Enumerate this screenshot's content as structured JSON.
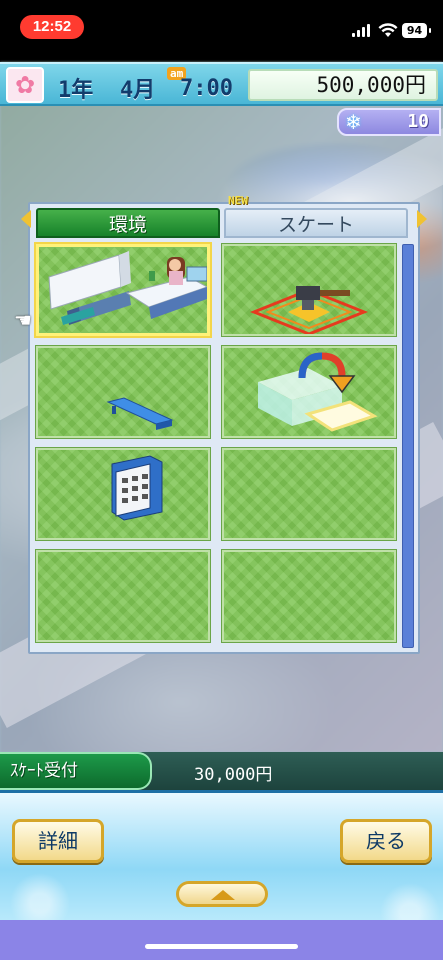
{
  "status_bar": {
    "time": "12:52",
    "battery": "94",
    "icons": [
      "signal-icon",
      "wifi-icon",
      "battery-icon"
    ]
  },
  "hud": {
    "year": "1年",
    "month": "4月",
    "ampm": "am",
    "time": "7:00",
    "money": "500,000円",
    "snow_count": "10",
    "icons": [
      "flower-icon",
      "snowflake-icon"
    ]
  },
  "catalog": {
    "tabs": [
      {
        "label": "環境",
        "active": true
      },
      {
        "label": "スケート",
        "active": false,
        "badge": "NEW"
      }
    ],
    "items": [
      {
        "name": "skate-reception-counter",
        "selected": true
      },
      {
        "name": "skate-rink-construct-tool",
        "selected": false
      },
      {
        "name": "bench",
        "selected": false
      },
      {
        "name": "move-rink-tool",
        "selected": false
      },
      {
        "name": "vending-machine",
        "selected": false
      },
      {
        "name": "empty-slot",
        "selected": false
      },
      {
        "name": "empty-slot",
        "selected": false
      },
      {
        "name": "empty-slot",
        "selected": false
      }
    ]
  },
  "selection": {
    "name": "ｽｹｰﾄ受付",
    "price": "30,000円"
  },
  "controls": {
    "details_label": "詳細",
    "back_label": "戻る"
  },
  "colors": {
    "hud_blue": "#4ab6d6",
    "tab_green": "#16822a",
    "grass": "#7fc653",
    "button_gold": "#d5a62a",
    "status_red": "#ff3b30"
  }
}
